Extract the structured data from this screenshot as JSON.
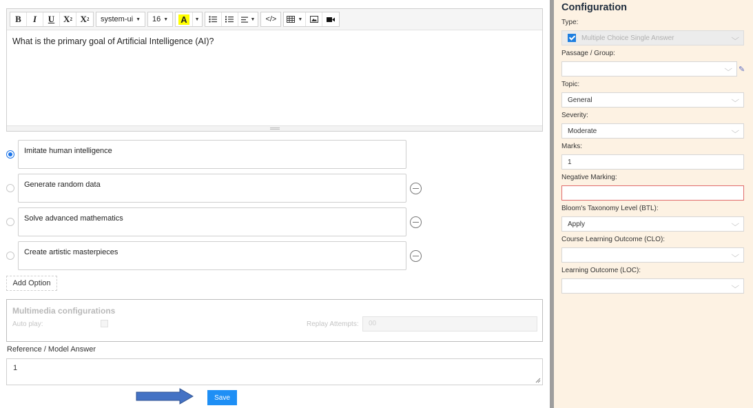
{
  "toolbar": {
    "bold": "B",
    "italic": "I",
    "underline": "U",
    "superscript": "X",
    "subscript": "X",
    "font_family": "system-ui",
    "font_size": "16",
    "text_color": "A",
    "code": "</>"
  },
  "editor": {
    "question": "What is the primary goal of Artificial Intelligence (AI)?"
  },
  "options": [
    {
      "text": "Imitate human intelligence",
      "selected": true
    },
    {
      "text": "Generate random data",
      "selected": false
    },
    {
      "text": "Solve advanced mathematics",
      "selected": false
    },
    {
      "text": "Create artistic masterpieces",
      "selected": false
    }
  ],
  "add_option_label": "Add Option",
  "multimedia": {
    "title": "Multimedia configurations",
    "auto_play_label": "Auto play:",
    "replay_label": "Replay Attempts:",
    "replay_value": "00"
  },
  "reference": {
    "label": "Reference / Model Answer",
    "value": "1"
  },
  "save_label": "Save",
  "config": {
    "title": "Configuration",
    "type_label": "Type:",
    "type_value": "Multiple Choice Single Answer",
    "passage_label": "Passage / Group:",
    "passage_value": "",
    "topic_label": "Topic:",
    "topic_value": "General",
    "severity_label": "Severity:",
    "severity_value": "Moderate",
    "marks_label": "Marks:",
    "marks_value": "1",
    "negative_label": "Negative Marking:",
    "negative_value": "",
    "btl_label": "Bloom's Taxonomy Level (BTL):",
    "btl_value": "Apply",
    "clo_label": "Course Learning Outcome (CLO):",
    "clo_value": "",
    "loc_label": "Learning Outcome (LOC):",
    "loc_value": ""
  },
  "colors": {
    "accent": "#1e8ff5",
    "panel_bg": "#fdf2e3",
    "error_border": "#e06b6b"
  }
}
